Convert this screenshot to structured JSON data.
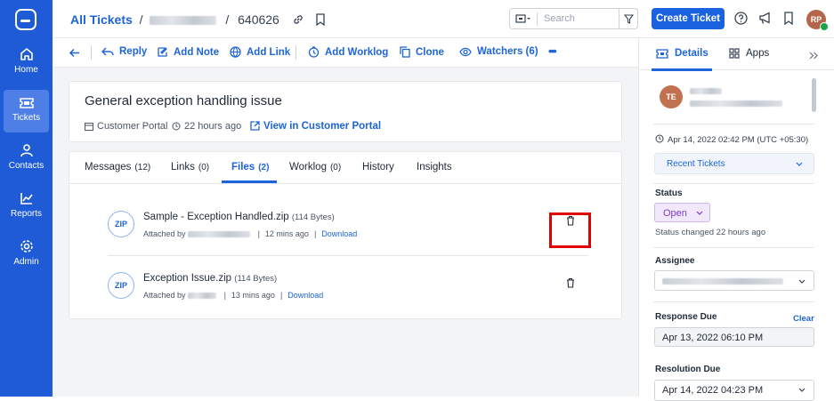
{
  "nav": {
    "items": [
      {
        "label": "Home",
        "icon": "home-icon"
      },
      {
        "label": "Tickets",
        "icon": "ticket-icon"
      },
      {
        "label": "Contacts",
        "icon": "contacts-icon"
      },
      {
        "label": "Reports",
        "icon": "reports-icon"
      },
      {
        "label": "Admin",
        "icon": "admin-icon"
      }
    ]
  },
  "header": {
    "breadcrumb_root": "All Tickets",
    "breadcrumb_sep": "/",
    "ticket_id": "640626",
    "search_placeholder": "Search",
    "create_label": "Create Ticket",
    "avatar_initials": "RP"
  },
  "toolbar": {
    "reply": "Reply",
    "add_note": "Add Note",
    "add_link": "Add Link",
    "add_worklog": "Add Worklog",
    "clone": "Clone",
    "watchers": "Watchers (6)",
    "more": "•••"
  },
  "ticket": {
    "title": "General exception handling issue",
    "source": "Customer Portal",
    "age": "22 hours ago",
    "portal_link": "View in Customer Portal"
  },
  "tabs": [
    {
      "label": "Messages",
      "count": "(12)"
    },
    {
      "label": "Links",
      "count": "(0)"
    },
    {
      "label": "Files",
      "count": "(2)"
    },
    {
      "label": "Worklog",
      "count": "(0)"
    },
    {
      "label": "History",
      "count": ""
    },
    {
      "label": "Insights",
      "count": ""
    }
  ],
  "files": [
    {
      "badge": "ZIP",
      "name": "Sample - Exception Handled.zip",
      "size": "(114 Bytes)",
      "attached_by": "Attached by",
      "time": "12 mins ago",
      "sep": "|",
      "download": "Download"
    },
    {
      "badge": "ZIP",
      "name": "Exception Issue.zip",
      "size": "(114 Bytes)",
      "attached_by": "Attached by",
      "time": "13 mins ago",
      "sep": "|",
      "download": "Download"
    }
  ],
  "details": {
    "tab_details": "Details",
    "tab_apps": "Apps",
    "requester_initials": "TE",
    "created": "Apr 14, 2022 02:42 PM (UTC +05:30)",
    "recent_tickets": "Recent Tickets",
    "status_label": "Status",
    "status_value": "Open",
    "status_changed": "Status changed 22 hours ago",
    "assignee_label": "Assignee",
    "response_due_label": "Response Due",
    "clear": "Clear",
    "response_due_value": "Apr 13, 2022 06:10 PM",
    "resolution_due_label": "Resolution Due",
    "resolution_due_value": "Apr 14, 2022 04:23 PM"
  },
  "colors": {
    "brand": "#1f5bd6",
    "link": "#1d64d8",
    "highlight": "#e00000",
    "status_bg": "#f1e8fb"
  }
}
